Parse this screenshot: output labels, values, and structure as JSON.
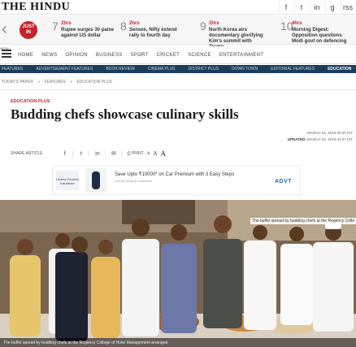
{
  "site": {
    "logo": "THE HINDU"
  },
  "social_icons": [
    "f",
    "t",
    "in",
    "g",
    "rss"
  ],
  "ticker": {
    "badge_line1": "JUST",
    "badge_line2": "IN",
    "items": [
      {
        "num": "7",
        "time": "2hrs",
        "headline": "Rupee surges 30 paise against US dollar"
      },
      {
        "num": "8",
        "time": "2hrs",
        "headline": "Sensex, Nifty extend rally to fourth day"
      },
      {
        "num": "9",
        "time": "2hrs",
        "headline": "North Korea airs documentary glorifying Kim's summit with Trump"
      },
      {
        "num": "10",
        "time": "4hrs",
        "headline": "Morning Digest: Opposition questions Modi govt on defencing"
      }
    ]
  },
  "nav": {
    "menu_label": "MENU",
    "items": [
      "HOME",
      "NEWS",
      "OPINION",
      "BUSINESS",
      "SPORT",
      "CRICKET",
      "SCIENCE",
      "ENTERTAINMENT"
    ]
  },
  "subnav": {
    "items": [
      "FEATURES",
      "ADVERTISEMENT FEATURES",
      "BOOK REVIEW",
      "CINEMA PLUS",
      "DISTRICT PLUS",
      "DOWN TOWN",
      "EDITORIAL FEATURES",
      "EDUCATION"
    ]
  },
  "breadcrumb": [
    "TODAY'S PAPER",
    "»",
    "FEATURES",
    "»",
    "EDUCATION PLUS"
  ],
  "article": {
    "section": "EDUCATION PLUS",
    "title": "Budding chefs showcase culinary skills",
    "published": "MARCH 04, 2019 00:00 IST",
    "updated_label": "UPDATED:",
    "updated": "MARCH 04, 2019 04:57 IST"
  },
  "share": {
    "label": "SHARE ARTICLE",
    "icons": [
      "f",
      "t",
      "in",
      "✉"
    ],
    "print_label": "PRINT",
    "font_sizes": [
      "A",
      "A",
      "A"
    ]
  },
  "ad": {
    "logo_text": "Liberty General Insurance",
    "text": "Save Upto ₹10000* on Car Premium with 3 Easy Steps",
    "brand": "Liberty General Insurance",
    "cta": "ADVT"
  },
  "photo": {
    "caption_top": "The buffet spread by budding chefs at the Regency Colle",
    "caption_bottom": "The buffet spread by budding chefs at the Regency College of Hotel Management arranged"
  },
  "colors": {
    "accent": "#c4232b",
    "subnav_bg": "#1c3d5a"
  }
}
